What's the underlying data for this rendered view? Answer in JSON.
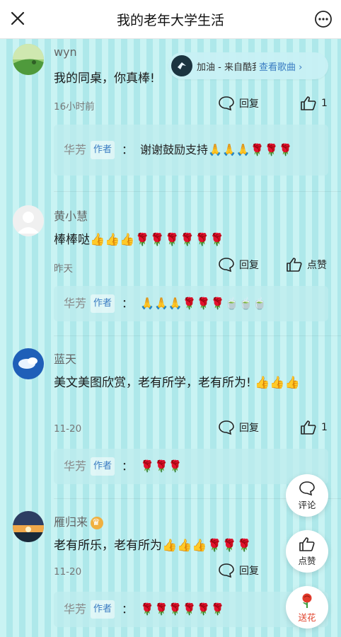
{
  "header": {
    "title": "我的老年大学生活",
    "close_icon": "close-icon",
    "more_icon": "more-icon"
  },
  "music": {
    "song": "加油 - 来自酷我",
    "view_label": "查看歌曲",
    "chevron": "›"
  },
  "comments": [
    {
      "user": "wyn",
      "text": "我的同桌，你真棒!",
      "time": "16小时前",
      "reply_label": "回复",
      "like_label": "1",
      "reply": {
        "name": "华芳",
        "badge": "作者",
        "colon": "：",
        "text": "谢谢鼓励支持🙏🙏🙏🌹🌹🌹"
      }
    },
    {
      "user": "黄小慧",
      "text": "棒棒哒👍👍👍🌹🌹🌹🌹🌹🌹",
      "time": "昨天",
      "reply_label": "回复",
      "like_label": "点赞",
      "reply": {
        "name": "华芳",
        "badge": "作者",
        "colon": "：",
        "text": "🙏🙏🙏🌹🌹🌹🍵🍵🍵"
      }
    },
    {
      "user": "蓝天",
      "text": "美文美图欣赏，老有所学，老有所为! 👍👍👍",
      "time": "11-20",
      "reply_label": "回复",
      "like_label": "1",
      "reply": {
        "name": "华芳",
        "badge": "作者",
        "colon": "：",
        "text": "🌹🌹🌹"
      }
    },
    {
      "user": "雁归来",
      "text": "老有所乐，老有所为👍👍👍🌹🌹🌹",
      "time": "11-20",
      "reply_label": "回复",
      "like_label": "",
      "reply": {
        "name": "华芳",
        "badge": "作者",
        "colon": "：",
        "text": "🌹🌹🌹🌹🌹🌹"
      }
    }
  ],
  "fabs": {
    "comment": "评论",
    "like": "点赞",
    "flower": "送花"
  }
}
